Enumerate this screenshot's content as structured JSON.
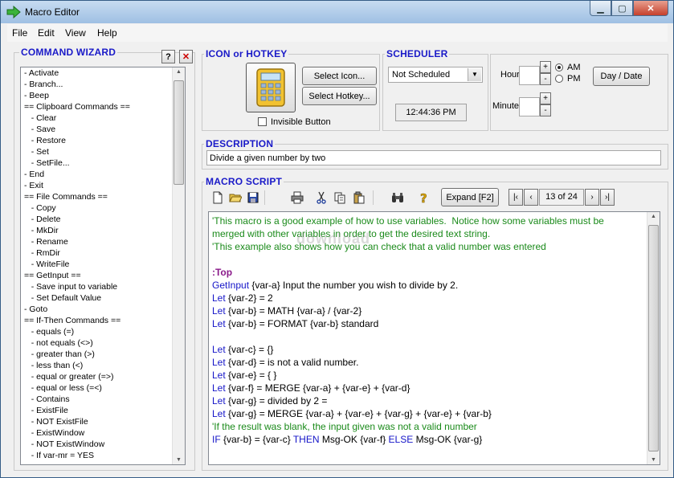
{
  "window": {
    "title": "Macro Editor"
  },
  "menu": {
    "file": "File",
    "edit": "Edit",
    "view": "View",
    "help": "Help"
  },
  "wizard": {
    "title": "COMMAND WIZARD",
    "help_label": "?",
    "close_label": "✕",
    "items": [
      "- Activate",
      "- Branch...",
      "- Beep",
      "== Clipboard Commands ==",
      "   - Clear",
      "   - Save",
      "   - Restore",
      "   - Set",
      "   - SetFile...",
      "- End",
      "- Exit",
      "== File Commands ==",
      "   - Copy",
      "   - Delete",
      "   - MkDir",
      "   - Rename",
      "   - RmDir",
      "   - WriteFile",
      "== GetInput ==",
      "   - Save input to variable",
      "   - Set Default Value",
      "- Goto",
      "== If-Then Commands ==",
      "   - equals (=)",
      "   - not equals (<>)",
      "   - greater than (>)",
      "   - less than (<)",
      "   - equal or greater (=>)",
      "   - equal or less (=<)",
      "   - Contains",
      "   - ExistFile",
      "   - NOT ExistFile",
      "   - ExistWindow",
      "   - NOT ExistWindow",
      "   - If var-mr = YES"
    ]
  },
  "icon_hotkey": {
    "title": "ICON or HOTKEY",
    "select_icon": "Select Icon...",
    "select_hotkey": "Select Hotkey...",
    "invisible_button": "Invisible Button"
  },
  "scheduler": {
    "title": "SCHEDULER",
    "selected": "Not Scheduled",
    "time": "12:44:36 PM",
    "hour_label": "Hour",
    "minute_label": "Minute",
    "am": "AM",
    "pm": "PM",
    "day_date": "Day / Date",
    "plus": "+",
    "minus": "-"
  },
  "description": {
    "title": "DESCRIPTION",
    "value": "Divide a given number by two"
  },
  "macro_script": {
    "title": "MACRO SCRIPT",
    "expand": "Expand [F2]",
    "page": "13 of 24",
    "watermark": "download",
    "lines": [
      {
        "parts": [
          {
            "c": "cm",
            "t": "'This macro is a good example of how to use variables.  Notice how some variables must be"
          }
        ]
      },
      {
        "parts": [
          {
            "c": "cm",
            "t": "merged with other variables in order to get the desired text string."
          }
        ]
      },
      {
        "parts": [
          {
            "c": "cm",
            "t": "'This example also shows how you can check that a valid number was entered"
          }
        ]
      },
      {
        "parts": [
          {
            "c": "",
            "t": ""
          }
        ]
      },
      {
        "parts": [
          {
            "c": "lb",
            "t": ":Top"
          }
        ]
      },
      {
        "parts": [
          {
            "c": "kw",
            "t": "GetInput"
          },
          {
            "c": "",
            "t": " {var-a} Input the number you wish to divide by 2."
          }
        ]
      },
      {
        "parts": [
          {
            "c": "kw",
            "t": "Let"
          },
          {
            "c": "",
            "t": " {var-2} = 2"
          }
        ]
      },
      {
        "parts": [
          {
            "c": "kw",
            "t": "Let"
          },
          {
            "c": "",
            "t": " {var-b} = MATH {var-a} / {var-2}"
          }
        ]
      },
      {
        "parts": [
          {
            "c": "kw",
            "t": "Let"
          },
          {
            "c": "",
            "t": " {var-b} = FORMAT {var-b} standard"
          }
        ]
      },
      {
        "parts": [
          {
            "c": "",
            "t": ""
          }
        ]
      },
      {
        "parts": [
          {
            "c": "kw",
            "t": "Let"
          },
          {
            "c": "",
            "t": " {var-c} = {}"
          }
        ]
      },
      {
        "parts": [
          {
            "c": "kw",
            "t": "Let"
          },
          {
            "c": "",
            "t": " {var-d} = is not a valid number."
          }
        ]
      },
      {
        "parts": [
          {
            "c": "kw",
            "t": "Let"
          },
          {
            "c": "",
            "t": " {var-e} = { }"
          }
        ]
      },
      {
        "parts": [
          {
            "c": "kw",
            "t": "Let"
          },
          {
            "c": "",
            "t": " {var-f} = MERGE {var-a} + {var-e} + {var-d}"
          }
        ]
      },
      {
        "parts": [
          {
            "c": "kw",
            "t": "Let"
          },
          {
            "c": "",
            "t": " {var-g} = divided by 2 ="
          }
        ]
      },
      {
        "parts": [
          {
            "c": "kw",
            "t": "Let"
          },
          {
            "c": "",
            "t": " {var-g} = MERGE {var-a} + {var-e} + {var-g} + {var-e} + {var-b}"
          }
        ]
      },
      {
        "parts": [
          {
            "c": "cm",
            "t": "'If the result was blank, the input given was not a valid number"
          }
        ]
      },
      {
        "parts": [
          {
            "c": "kw",
            "t": "IF"
          },
          {
            "c": "",
            "t": " {var-b} = {var-c} "
          },
          {
            "c": "kw",
            "t": "THEN"
          },
          {
            "c": "",
            "t": " Msg-OK {var-f} "
          },
          {
            "c": "kw",
            "t": "ELSE"
          },
          {
            "c": "",
            "t": " Msg-OK {var-g}"
          }
        ]
      }
    ]
  }
}
